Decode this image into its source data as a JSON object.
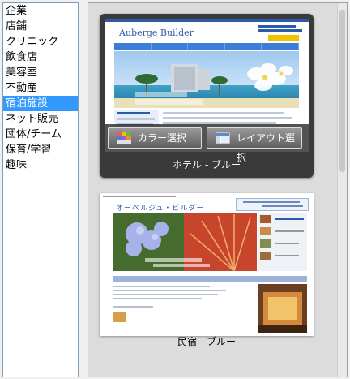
{
  "categories": [
    "企業",
    "店舗",
    "クリニック",
    "飲食店",
    "美容室",
    "不動産",
    "宿泊施設",
    "ネット販売",
    "団体/チーム",
    "保育/学習",
    "趣味"
  ],
  "selected_category": "宿泊施設",
  "templates": [
    {
      "caption": "ホテル - ブルー",
      "selected": true,
      "site_logo": "Auberge Builder",
      "color_button": "カラー選択",
      "layout_button": "レイアウト選択"
    },
    {
      "caption": "民宿 - ブルー",
      "selected": false,
      "site_logo": "オーベルジュ・ビルダー"
    }
  ],
  "colors": {
    "selection": "#3399ff",
    "card_dark": "#3a3a3a",
    "accent_blue": "#2b5aa8"
  }
}
